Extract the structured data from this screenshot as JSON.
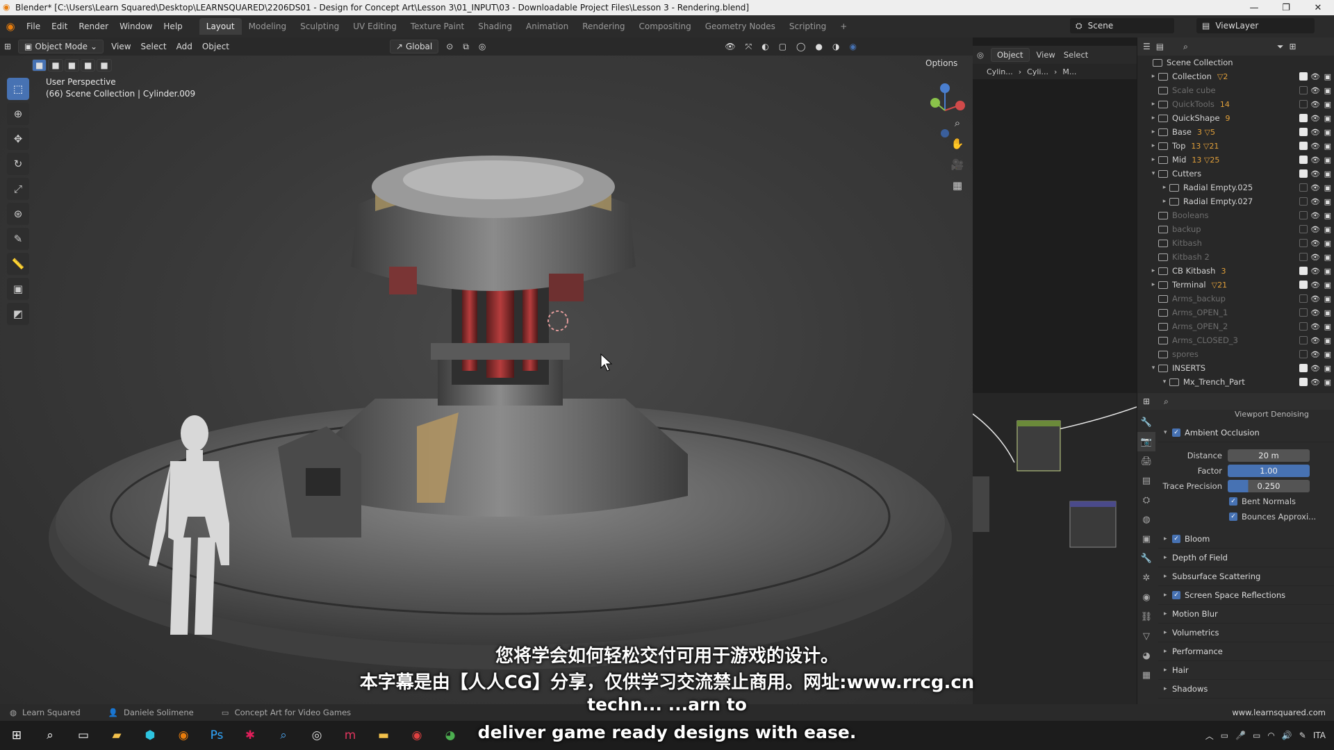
{
  "title_bar": {
    "text": "Blender* [C:\\Users\\Learn Squared\\Desktop\\LEARNSQUARED\\2206DS01 - Design for Concept Art\\Lesson 3\\01_INPUT\\03 - Downloadable Project Files\\Lesson 3 - Rendering.blend]"
  },
  "menu": {
    "items": [
      "File",
      "Edit",
      "Render",
      "Window",
      "Help"
    ]
  },
  "workspaces": {
    "active": "Layout",
    "tabs": [
      "Layout",
      "Modeling",
      "Sculpting",
      "UV Editing",
      "Texture Paint",
      "Shading",
      "Animation",
      "Rendering",
      "Compositing",
      "Geometry Nodes",
      "Scripting"
    ],
    "add": "+"
  },
  "scene": {
    "label": "Scene",
    "view_layer": "ViewLayer"
  },
  "viewport_header": {
    "mode": "Object Mode",
    "items": [
      "View",
      "Select",
      "Add",
      "Object"
    ],
    "orientation": "Global",
    "options": "Options"
  },
  "viewport_info": {
    "line1": "User Perspective",
    "line2": "(66) Scene Collection | Cylinder.009"
  },
  "node_header": {
    "mode": "Object",
    "items": [
      "View",
      "Select"
    ],
    "crumb1": "Cylin...",
    "crumb2": "Cyli...",
    "crumb3": "M..."
  },
  "outliner": {
    "rows": [
      {
        "label": "Scene Collection",
        "dim": false,
        "arrow": "",
        "badge": "",
        "check": false
      },
      {
        "label": "Collection",
        "dim": false,
        "arrow": "▸",
        "badge": "▽2",
        "check": true
      },
      {
        "label": "Scale cube",
        "dim": true,
        "arrow": "",
        "badge": "",
        "check": false
      },
      {
        "label": "QuickTools",
        "dim": true,
        "arrow": "▸",
        "badge": "14",
        "check": false
      },
      {
        "label": "QuickShape",
        "dim": false,
        "arrow": "▸",
        "badge": "9",
        "check": true
      },
      {
        "label": "Base",
        "dim": false,
        "arrow": "▸",
        "badge": "3 ▽5",
        "check": true
      },
      {
        "label": "Top",
        "dim": false,
        "arrow": "▸",
        "badge": "13 ▽21",
        "check": true
      },
      {
        "label": "Mid",
        "dim": false,
        "arrow": "▸",
        "badge": "13 ▽25",
        "check": true
      },
      {
        "label": "Cutters",
        "dim": false,
        "arrow": "▾",
        "badge": "",
        "check": true
      },
      {
        "label": "Radial Empty.025",
        "dim": false,
        "arrow": "▸",
        "badge": "",
        "check": false,
        "indent": true
      },
      {
        "label": "Radial Empty.027",
        "dim": false,
        "arrow": "▸",
        "badge": "",
        "check": false,
        "indent": true
      },
      {
        "label": "Booleans",
        "dim": true,
        "arrow": "",
        "badge": "",
        "check": false
      },
      {
        "label": "backup",
        "dim": true,
        "arrow": "",
        "badge": "",
        "check": false
      },
      {
        "label": "Kitbash",
        "dim": true,
        "arrow": "",
        "badge": "",
        "check": false
      },
      {
        "label": "Kitbash 2",
        "dim": true,
        "arrow": "",
        "badge": "",
        "check": false
      },
      {
        "label": "CB Kitbash",
        "dim": false,
        "arrow": "▸",
        "badge": "3",
        "check": true
      },
      {
        "label": "Terminal",
        "dim": false,
        "arrow": "▸",
        "badge": "▽21",
        "check": true
      },
      {
        "label": "Arms_backup",
        "dim": true,
        "arrow": "",
        "badge": "",
        "check": false
      },
      {
        "label": "Arms_OPEN_1",
        "dim": true,
        "arrow": "",
        "badge": "",
        "check": false
      },
      {
        "label": "Arms_OPEN_2",
        "dim": true,
        "arrow": "",
        "badge": "",
        "check": false
      },
      {
        "label": "Arms_CLOSED_3",
        "dim": true,
        "arrow": "",
        "badge": "",
        "check": false
      },
      {
        "label": "spores",
        "dim": true,
        "arrow": "",
        "badge": "",
        "check": false
      },
      {
        "label": "INSERTS",
        "dim": false,
        "arrow": "▾",
        "badge": "",
        "check": true
      },
      {
        "label": "Mx_Trench_Part",
        "dim": false,
        "arrow": "▾",
        "badge": "",
        "check": true,
        "indent": true
      }
    ]
  },
  "properties": {
    "top_label": "Viewport Denoising",
    "ao": {
      "label": "Ambient Occlusion",
      "distance_label": "Distance",
      "distance": "20 m",
      "factor_label": "Factor",
      "factor": "1.00",
      "trace_label": "Trace Precision",
      "trace": "0.250",
      "bent": "Bent Normals",
      "bounces": "Bounces Approxi..."
    },
    "sections": [
      {
        "label": "Bloom",
        "checkbox": true
      },
      {
        "label": "Depth of Field",
        "checkbox": false
      },
      {
        "label": "Subsurface Scattering",
        "checkbox": false
      },
      {
        "label": "Screen Space Reflections",
        "checkbox": true
      },
      {
        "label": "Motion Blur",
        "checkbox": false
      },
      {
        "label": "Volumetrics",
        "checkbox": false
      },
      {
        "label": "Performance",
        "checkbox": false
      },
      {
        "label": "Hair",
        "checkbox": false
      },
      {
        "label": "Shadows",
        "checkbox": false
      }
    ]
  },
  "subtitles": {
    "cn1": "您将学会如何轻松交付可用于游戏的设计。",
    "cn2": "本字幕是由【人人CG】分享，仅供学习交流禁止商用。网址:www.rrcg.cn",
    "en1": "techn... ...arn to",
    "en2": "deliver game ready designs with ease."
  },
  "statusbar": {
    "item1": "Learn Squared",
    "item2": "Daniele Solimene",
    "item3": "Concept Art for Video Games",
    "site": "www.learnsquared.com"
  },
  "taskbar": {
    "time": "ITA"
  },
  "colors": {
    "accent": "#4772b3",
    "orange": "#e87d0d"
  }
}
